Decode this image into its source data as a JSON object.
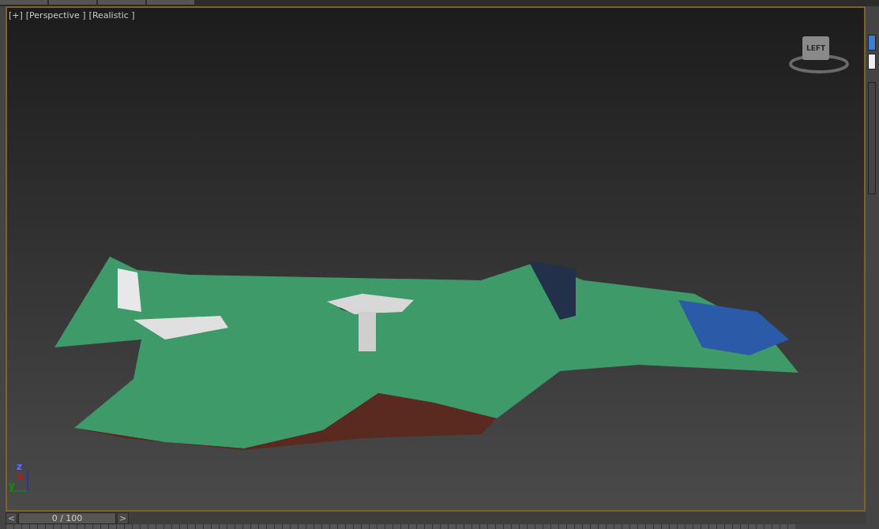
{
  "viewport": {
    "labels": [
      "[+]",
      "[Perspective ]",
      "[Realistic ]"
    ],
    "view_cube": {
      "face": "LEFT"
    },
    "axes": [
      {
        "label": "z",
        "color": "#6a6aff"
      },
      {
        "label": "x",
        "color": "#c01818"
      },
      {
        "label": "y",
        "color": "#109010"
      }
    ]
  },
  "time_slider": {
    "prev": "<",
    "position": "0 / 100",
    "next": ">",
    "level": 0
  }
}
